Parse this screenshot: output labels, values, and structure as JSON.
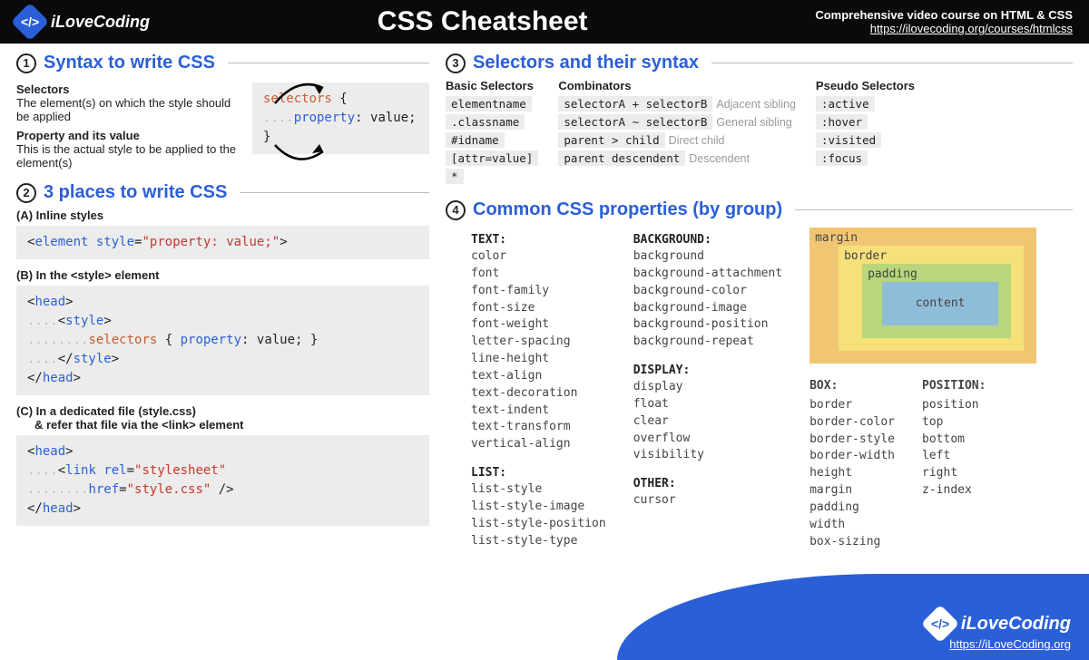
{
  "brand": "iLoveCoding",
  "title": "CSS Cheatsheet",
  "course": {
    "label": "Comprehensive video course on HTML & CSS",
    "url": "https://ilovecoding.org/courses/htmlcss"
  },
  "s1": {
    "num": "1",
    "title": "Syntax to write CSS",
    "selectors_h": "Selectors",
    "selectors_d": "The element(s) on which the style should be applied",
    "propval_h": "Property and its value",
    "propval_d": "This is the actual style to be applied to the element(s)",
    "code": {
      "sel": "selectors",
      "open": " {",
      "dots": "....",
      "prop": "property",
      "val": ": value;",
      "close": "}"
    }
  },
  "s2": {
    "num": "2",
    "title": "3 places to write CSS",
    "a_h": "(A) Inline styles",
    "b_h": "(B) In the <style> element",
    "c_h": "(C) In a dedicated file (style.css)",
    "c_sub": "& refer that file via the <link> element"
  },
  "s3": {
    "num": "3",
    "title": "Selectors and their syntax",
    "basic_h": "Basic Selectors",
    "basic": [
      "elementname",
      ".classname",
      "#idname",
      "[attr=value]",
      "*"
    ],
    "comb_h": "Combinators",
    "comb": [
      {
        "sel": "selectorA + selectorB",
        "note": "Adjacent sibling"
      },
      {
        "sel": "selectorA ~ selectorB",
        "note": "General sibling"
      },
      {
        "sel": "parent > child",
        "note": "Direct child"
      },
      {
        "sel": "parent descendent",
        "note": "Descendent"
      }
    ],
    "pseudo_h": "Pseudo Selectors",
    "pseudo": [
      ":active",
      ":hover",
      ":visited",
      ":focus"
    ]
  },
  "s4": {
    "num": "4",
    "title": "Common CSS properties (by group)",
    "text_h": "TEXT:",
    "text": [
      "color",
      "font",
      "font-family",
      "font-size",
      "font-weight",
      "letter-spacing",
      "line-height",
      "text-align",
      "text-decoration",
      "text-indent",
      "text-transform",
      "vertical-align"
    ],
    "list_h": "LIST:",
    "list": [
      "list-style",
      "list-style-image",
      "list-style-position",
      "list-style-type"
    ],
    "bg_h": "BACKGROUND:",
    "bg": [
      "background",
      "background-attachment",
      "background-color",
      "background-image",
      "background-position",
      "background-repeat"
    ],
    "disp_h": "DISPLAY:",
    "disp": [
      "display",
      "float",
      "clear",
      "overflow",
      "visibility"
    ],
    "other_h": "OTHER:",
    "other": [
      "cursor"
    ],
    "box_h": "BOX:",
    "box": [
      "border",
      "border-color",
      "border-style",
      "border-width",
      "height",
      "margin",
      "padding",
      "width",
      "box-sizing"
    ],
    "pos_h": "POSITION:",
    "pos": [
      "position",
      "top",
      "bottom",
      "left",
      "right",
      "z-index"
    ],
    "bm": {
      "margin": "margin",
      "border": "border",
      "padding": "padding",
      "content": "content"
    }
  },
  "footer": {
    "brand": "iLoveCoding",
    "url": "https://iLoveCoding.org"
  }
}
